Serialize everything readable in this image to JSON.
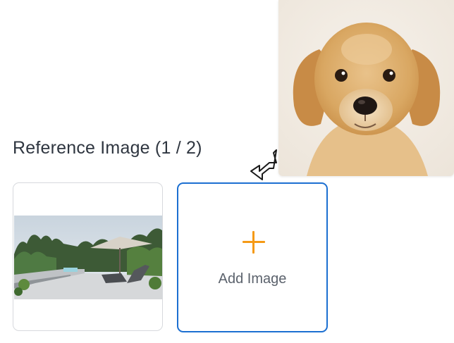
{
  "reference_section": {
    "title": "Reference Image (1 / 2)"
  },
  "add_card": {
    "label": "Add Image",
    "plus_icon": "plus-icon"
  },
  "icons": {
    "cursor": "drag-cursor-icon"
  },
  "colors": {
    "accent_border": "#1c6fd1",
    "plus": "#f59a16",
    "title_text": "#2f3640",
    "label_text": "#5b626c"
  }
}
